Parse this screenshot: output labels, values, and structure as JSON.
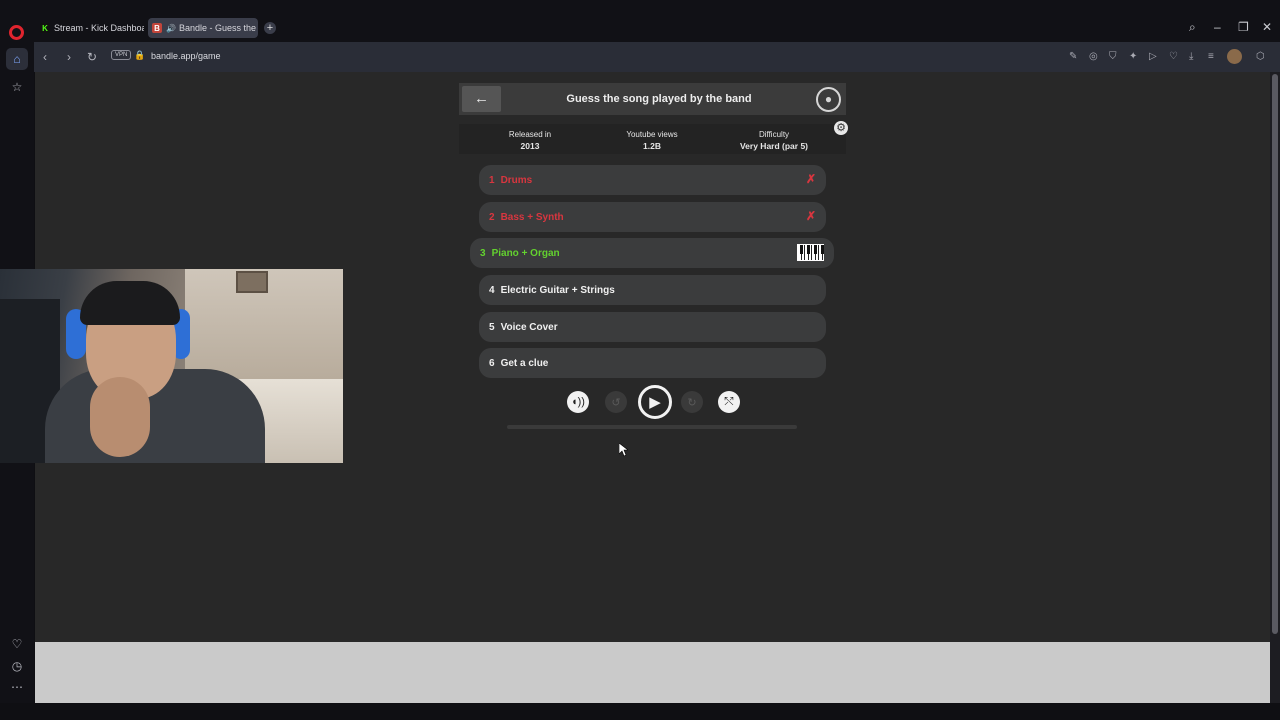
{
  "browser": {
    "tabs": [
      {
        "label": "Stream - Kick Dashboard",
        "favicon": "K"
      },
      {
        "label": "Bandle - Guess the so",
        "favicon": "B"
      }
    ],
    "new_tab_glyph": "+",
    "vpn_label": "VPN",
    "url": "bandle.app/game"
  },
  "game": {
    "title": "Guess the song played by the band",
    "info": [
      {
        "label": "Released in",
        "value": "2013"
      },
      {
        "label": "Youtube views",
        "value": "1.2B"
      },
      {
        "label": "Difficulty",
        "value": "Very Hard (par 5)"
      }
    ],
    "tracks": [
      {
        "num": "1",
        "label": "Drums",
        "state": "failed"
      },
      {
        "num": "2",
        "label": "Bass + Synth",
        "state": "failed"
      },
      {
        "num": "3",
        "label": "Piano + Organ",
        "state": "active"
      },
      {
        "num": "4",
        "label": "Electric Guitar + Strings",
        "state": "locked"
      },
      {
        "num": "5",
        "label": "Voice Cover",
        "state": "locked"
      },
      {
        "num": "6",
        "label": "Get a clue",
        "state": "locked"
      }
    ],
    "progress": 0,
    "colors": {
      "failed": "#d8363f",
      "active": "#63d12f",
      "background": "#282828",
      "track_bg": "#3b3c3d"
    }
  }
}
